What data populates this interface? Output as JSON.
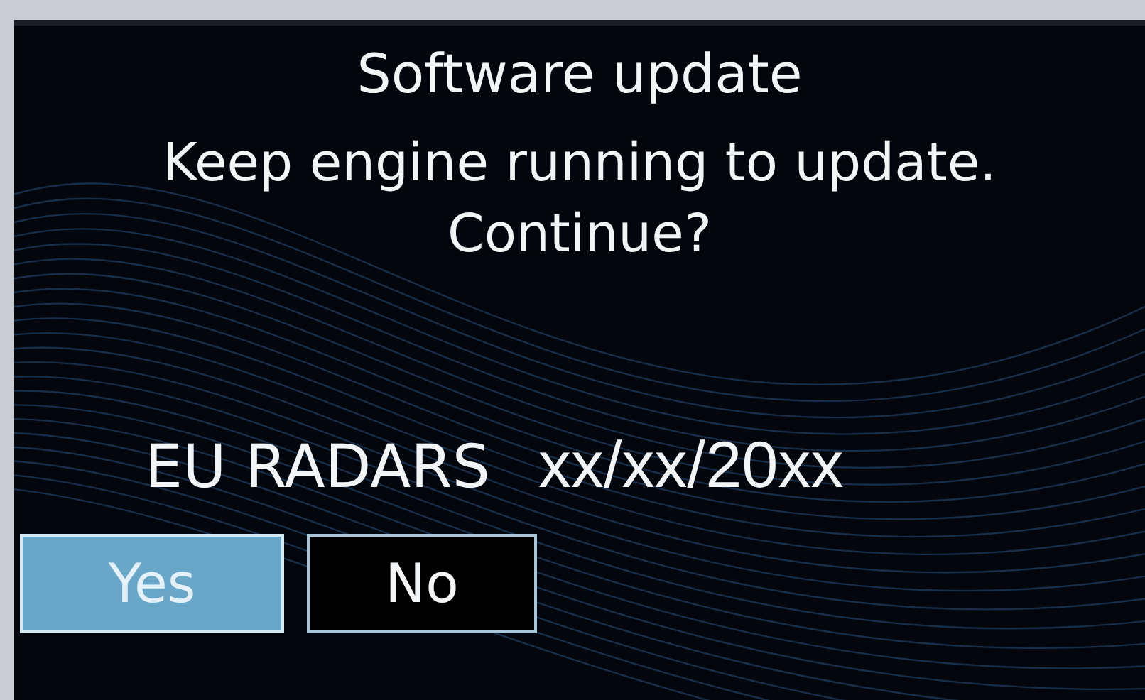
{
  "dialog": {
    "title": "Software update",
    "message": [
      "Keep engine running to update.",
      "Continue?"
    ],
    "map_database": {
      "name": "EU RADARS",
      "date": "xx/xx/20xx"
    },
    "buttons": [
      {
        "label": "Yes",
        "selected": true
      },
      {
        "label": "No",
        "selected": false
      }
    ]
  }
}
